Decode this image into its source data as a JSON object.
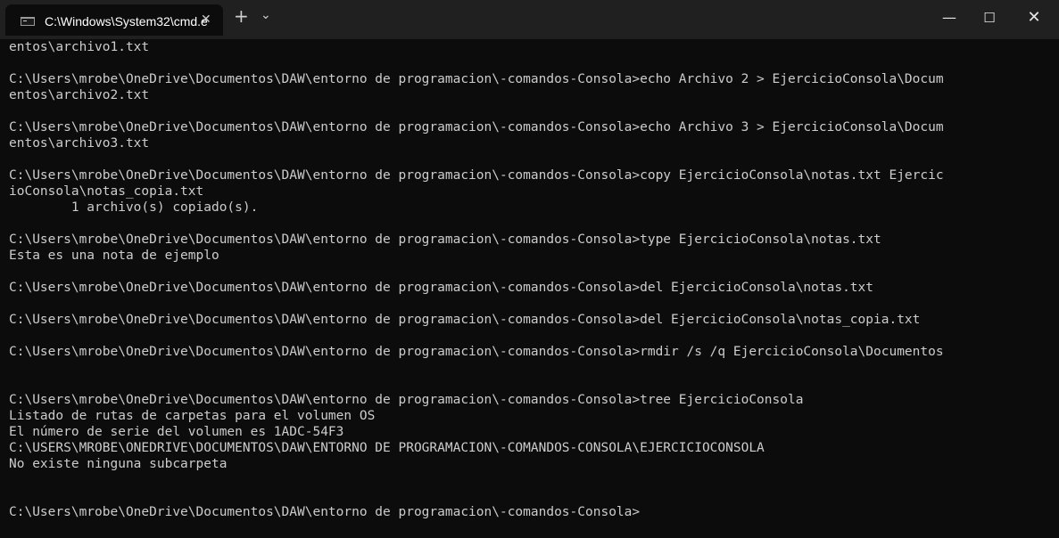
{
  "titlebar": {
    "tab_title": "C:\\Windows\\System32\\cmd.e",
    "tab_close_glyph": "✕",
    "new_tab_glyph": "+",
    "dropdown_glyph": "⌄",
    "minimize_glyph": "—",
    "maximize_glyph": "☐",
    "close_glyph": "✕"
  },
  "colors": {
    "console_background": "#0c0c0c",
    "console_text": "#cccccc",
    "titlebar_background": "#202020"
  },
  "console": {
    "lines": [
      "entos\\archivo1.txt",
      "",
      "C:\\Users\\mrobe\\OneDrive\\Documentos\\DAW\\entorno de programacion\\-comandos-Consola>echo Archivo 2 > EjercicioConsola\\Docum",
      "entos\\archivo2.txt",
      "",
      "C:\\Users\\mrobe\\OneDrive\\Documentos\\DAW\\entorno de programacion\\-comandos-Consola>echo Archivo 3 > EjercicioConsola\\Docum",
      "entos\\archivo3.txt",
      "",
      "C:\\Users\\mrobe\\OneDrive\\Documentos\\DAW\\entorno de programacion\\-comandos-Consola>copy EjercicioConsola\\notas.txt Ejercic",
      "ioConsola\\notas_copia.txt",
      "        1 archivo(s) copiado(s).",
      "",
      "C:\\Users\\mrobe\\OneDrive\\Documentos\\DAW\\entorno de programacion\\-comandos-Consola>type EjercicioConsola\\notas.txt",
      "Esta es una nota de ejemplo",
      "",
      "C:\\Users\\mrobe\\OneDrive\\Documentos\\DAW\\entorno de programacion\\-comandos-Consola>del EjercicioConsola\\notas.txt",
      "",
      "C:\\Users\\mrobe\\OneDrive\\Documentos\\DAW\\entorno de programacion\\-comandos-Consola>del EjercicioConsola\\notas_copia.txt",
      "",
      "C:\\Users\\mrobe\\OneDrive\\Documentos\\DAW\\entorno de programacion\\-comandos-Consola>rmdir /s /q EjercicioConsola\\Documentos",
      "",
      "",
      "C:\\Users\\mrobe\\OneDrive\\Documentos\\DAW\\entorno de programacion\\-comandos-Consola>tree EjercicioConsola",
      "Listado de rutas de carpetas para el volumen OS",
      "El número de serie del volumen es 1ADC-54F3",
      "C:\\USERS\\MROBE\\ONEDRIVE\\DOCUMENTOS\\DAW\\ENTORNO DE PROGRAMACION\\-COMANDOS-CONSOLA\\EJERCICIOCONSOLA",
      "No existe ninguna subcarpeta",
      "",
      "",
      "C:\\Users\\mrobe\\OneDrive\\Documentos\\DAW\\entorno de programacion\\-comandos-Consola>"
    ]
  }
}
